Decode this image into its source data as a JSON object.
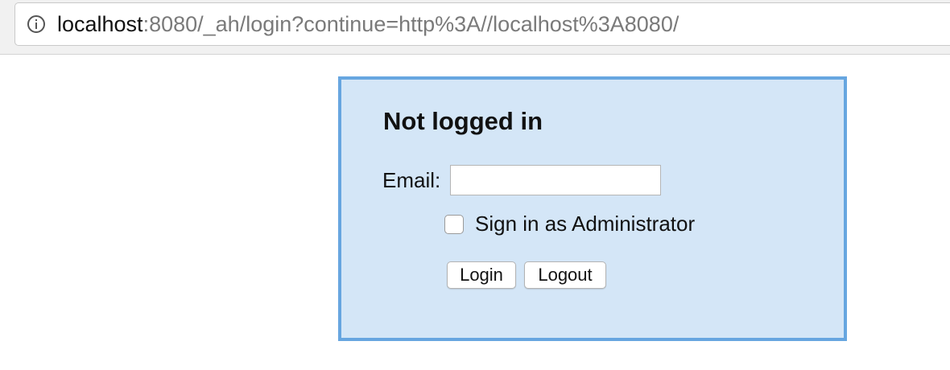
{
  "browser": {
    "url_host": "localhost",
    "url_rest": ":8080/_ah/login?continue=http%3A//localhost%3A8080/",
    "info_icon": "info-icon"
  },
  "login": {
    "title": "Not logged in",
    "email_label": "Email:",
    "email_value": "",
    "admin_checkbox_label": "Sign in as Administrator",
    "admin_checked": false,
    "login_button": "Login",
    "logout_button": "Logout"
  },
  "colors": {
    "panel_background": "#d4e6f7",
    "panel_border": "#67a6e0"
  }
}
